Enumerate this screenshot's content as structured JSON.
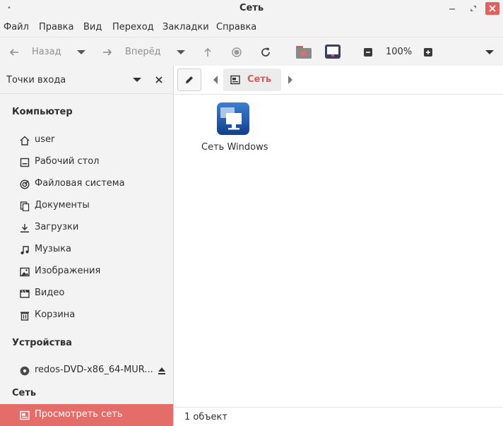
{
  "window": {
    "title": "Сеть"
  },
  "menu": [
    "Файл",
    "Правка",
    "Вид",
    "Переход",
    "Закладки",
    "Справка"
  ],
  "toolbar": {
    "back_label": "Назад",
    "forward_label": "Вперёд",
    "zoom": "100%"
  },
  "sidebar": {
    "header": "Точки входа",
    "sections": {
      "computer": "Компьютер",
      "devices": "Устройства",
      "network": "Сеть"
    },
    "computer_items": [
      {
        "label": "user",
        "icon": "home-icon"
      },
      {
        "label": "Рабочий стол",
        "icon": "desktop-icon"
      },
      {
        "label": "Файловая система",
        "icon": "filesystem-icon"
      },
      {
        "label": "Документы",
        "icon": "documents-icon"
      },
      {
        "label": "Загрузки",
        "icon": "downloads-icon"
      },
      {
        "label": "Музыка",
        "icon": "music-icon"
      },
      {
        "label": "Изображения",
        "icon": "pictures-icon"
      },
      {
        "label": "Видео",
        "icon": "video-icon"
      },
      {
        "label": "Корзина",
        "icon": "trash-icon"
      }
    ],
    "device_items": [
      {
        "label": "redos-DVD-x86_64-MUR...",
        "icon": "disc-icon"
      }
    ],
    "network_items": [
      {
        "label": "Просмотреть сеть",
        "icon": "network-icon"
      }
    ]
  },
  "pathbar": {
    "crumb": "Сеть"
  },
  "content": {
    "files": [
      {
        "label": "Сеть Windows",
        "icon": "windows-network-icon"
      }
    ]
  },
  "status": {
    "text": "1 объект"
  },
  "colors": {
    "accent": "#e46c69",
    "crumb_text": "#e05a55",
    "panel_bg": "#f3f3f3"
  }
}
